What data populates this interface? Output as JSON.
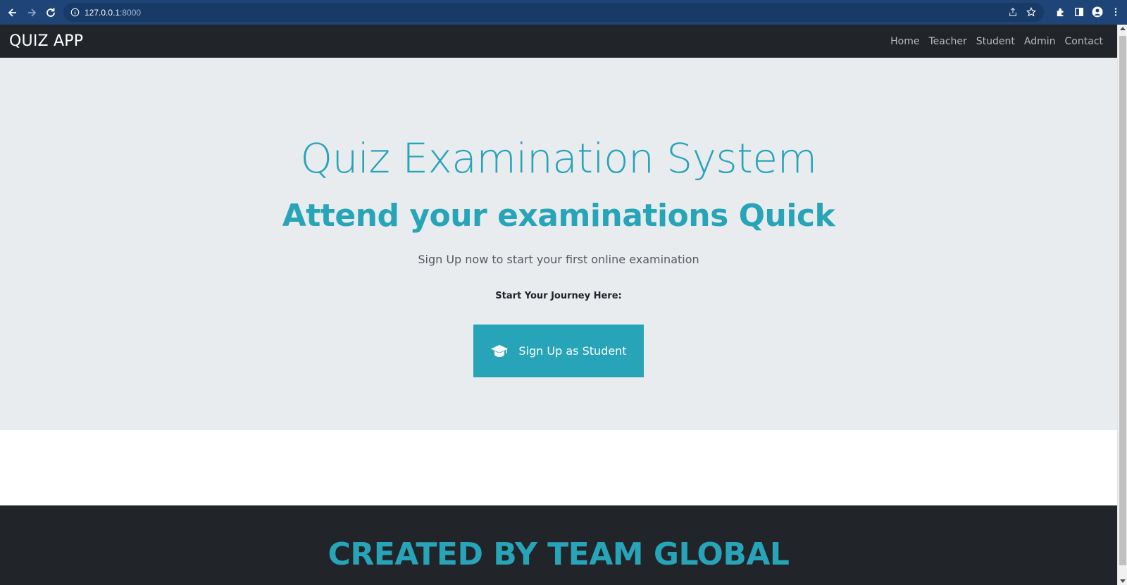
{
  "browser": {
    "url_host": "127.0.0.1",
    "url_port": ":8000"
  },
  "navbar": {
    "brand": "QUIZ APP",
    "links": [
      "Home",
      "Teacher",
      "Student",
      "Admin",
      "Contact"
    ]
  },
  "hero": {
    "title": "Quiz Examination System",
    "subtitle": "Attend your examinations Quick",
    "lead": "Sign Up now to start your first online examination",
    "cta_label": "Start Your Journey Here:",
    "button_label": "Sign Up as Student",
    "button_icon": "graduation-cap-icon"
  },
  "footer": {
    "title": "CREATED BY TEAM GLOBAL"
  },
  "colors": {
    "accent": "#27a4b8",
    "navbar_bg": "#212529",
    "hero_bg": "#e8ecef",
    "browser_bar": "#1e4478"
  }
}
